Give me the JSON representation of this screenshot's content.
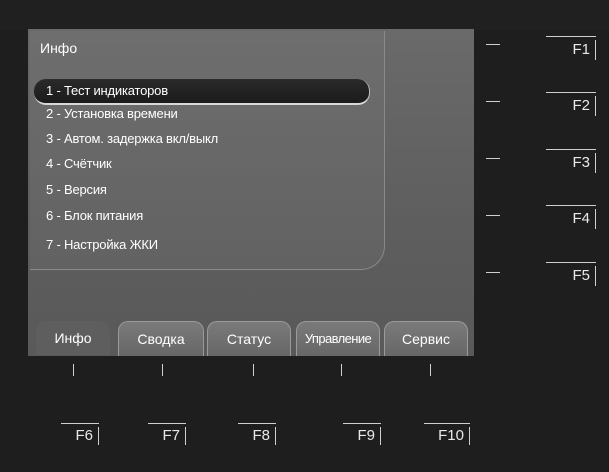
{
  "panel": {
    "title": "Инфо"
  },
  "menu": {
    "items": [
      {
        "label": "1 - Тест индикаторов",
        "selected": true
      },
      {
        "label": "2 - Установка времени",
        "selected": false
      },
      {
        "label": "3 - Автом. задержка вкл/выкл",
        "selected": false
      },
      {
        "label": "4 - Счётчик",
        "selected": false
      },
      {
        "label": "5 - Версия",
        "selected": false
      },
      {
        "label": "6 - Блок питания",
        "selected": false
      },
      {
        "label": "7 - Настройка ЖКИ",
        "selected": false
      }
    ]
  },
  "tabs": [
    {
      "label": "Инфо",
      "active": true
    },
    {
      "label": "Сводка",
      "active": false
    },
    {
      "label": "Статус",
      "active": false
    },
    {
      "label": "Управление",
      "active": false
    },
    {
      "label": "Сервис",
      "active": false
    }
  ],
  "right_keys": [
    "F1",
    "F2",
    "F3",
    "F4",
    "F5"
  ],
  "bottom_keys": [
    "F6",
    "F7",
    "F8",
    "F9",
    "F10"
  ]
}
